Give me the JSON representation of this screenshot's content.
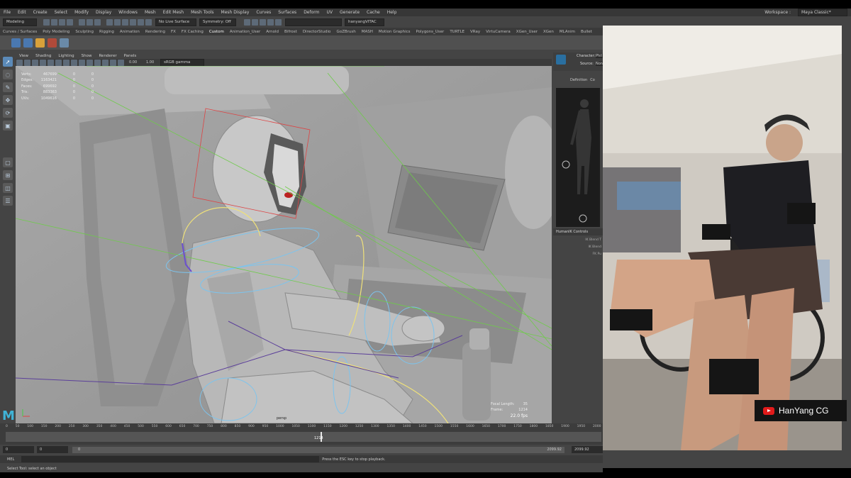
{
  "menu": [
    "File",
    "Edit",
    "Create",
    "Select",
    "Modify",
    "Display",
    "Windows",
    "Mesh",
    "Edit Mesh",
    "Mesh Tools",
    "Mesh Display",
    "Curves",
    "Surfaces",
    "Deform",
    "UV",
    "Generate",
    "Cache",
    "Help"
  ],
  "status_line": {
    "mode": "Modeling",
    "live_surface": "No Live Surface",
    "symmetry": "Symmetry: Off",
    "user": "hanyangVITAC",
    "workspace_label": "Workspace :",
    "workspace": "Maya Classic*"
  },
  "shelf_tabs": [
    "Curves / Surfaces",
    "Poly Modeling",
    "Sculpting",
    "Rigging",
    "Animation",
    "Rendering",
    "FX",
    "FX Caching",
    "Custom",
    "Animation_User",
    "Arnold",
    "Bifrost",
    "DirectorStudio",
    "GoZBrush",
    "MASH",
    "Motion Graphics",
    "Polygons_User",
    "TURTLE",
    "VRay",
    "VirtuCamera",
    "XGen_User",
    "XGen",
    "MLAnim",
    "Bullet"
  ],
  "viewport": {
    "menu": [
      "View",
      "Shading",
      "Lighting",
      "Show",
      "Renderer",
      "Panels"
    ],
    "colorspace": "sRGB gamma",
    "exposure": "0.00",
    "gamma": "1.00",
    "camera": "persp",
    "hud_stats": [
      {
        "label": "Verts:",
        "value": "467699",
        "a": "0",
        "b": "0"
      },
      {
        "label": "Edges:",
        "value": "1163421",
        "a": "0",
        "b": "0"
      },
      {
        "label": "Faces:",
        "value": "699692",
        "a": "0",
        "b": "0"
      },
      {
        "label": "Tris:",
        "value": "883363",
        "a": "0",
        "b": "0"
      },
      {
        "label": "UVs:",
        "value": "1049616",
        "a": "0",
        "b": "0"
      }
    ],
    "focal_label": "Focal Length:",
    "focal_value": "35",
    "frame_label": "Frame:",
    "frame_value": "1214",
    "fps": "22.0 fps"
  },
  "hik": {
    "character_label": "Character:",
    "character": "Phil",
    "source_label": "Source:",
    "source": "Non",
    "tab_definition": "Definition",
    "tab_controls": "Co",
    "controls_header": "HumanIK Controls",
    "controls_items": [
      "IK Blend T",
      "IK Blend",
      "FK Pu"
    ]
  },
  "timeline": {
    "ticks": [
      "0",
      "50",
      "100",
      "150",
      "200",
      "250",
      "300",
      "350",
      "400",
      "450",
      "500",
      "550",
      "600",
      "650",
      "700",
      "750",
      "800",
      "850",
      "900",
      "950",
      "1000",
      "1050",
      "1100",
      "1150",
      "1200",
      "1250",
      "1300",
      "1350",
      "1400",
      "1450",
      "1500",
      "1550",
      "1600",
      "1650",
      "1700",
      "1750",
      "1800",
      "1850",
      "1900",
      "1950",
      "2000"
    ],
    "current": "1214",
    "range_start": "0",
    "range_start2": "0",
    "range_slider_start": "0",
    "range_end": "2099.92",
    "range_end2": "2099.92"
  },
  "command_line": {
    "lang": "MEL",
    "message": "Press the ESC key to stop playback."
  },
  "help_line": "Select Tool: select an object",
  "badge": "HanYang CG",
  "colors": {
    "accent": "#5b8ab8",
    "youtube_red": "#e21b1b"
  }
}
